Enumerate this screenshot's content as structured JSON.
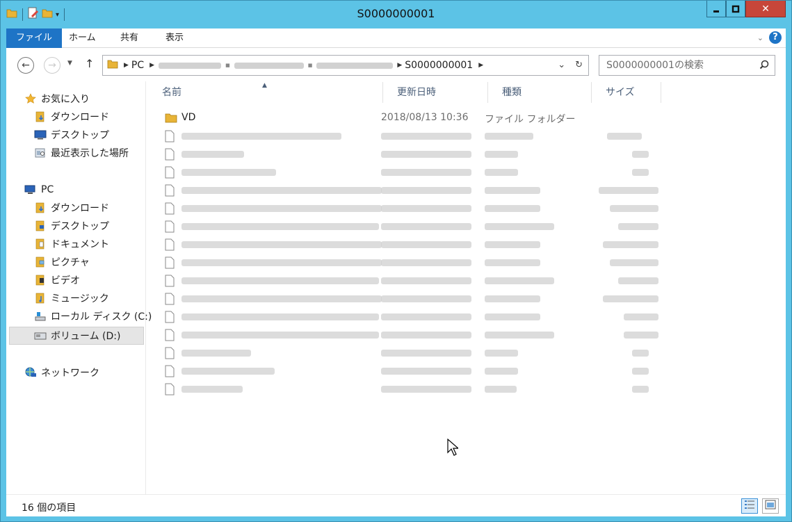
{
  "window": {
    "title": "S0000000001"
  },
  "ribbon": {
    "tabs": [
      {
        "label": "ファイル"
      },
      {
        "label": "ホーム"
      },
      {
        "label": "共有"
      },
      {
        "label": "表示"
      }
    ]
  },
  "address": {
    "crumbs": [
      "PC",
      "S0000000001"
    ],
    "search_placeholder": "S0000000001の検索"
  },
  "nav": {
    "favorites_label": "お気に入り",
    "favorites": [
      {
        "label": "ダウンロード",
        "icon": "download-folder-icon"
      },
      {
        "label": "デスクトップ",
        "icon": "desktop-icon"
      },
      {
        "label": "最近表示した場所",
        "icon": "recent-places-icon"
      }
    ],
    "pc_label": "PC",
    "pc_items": [
      {
        "label": "ダウンロード",
        "icon": "download-folder-icon"
      },
      {
        "label": "デスクトップ",
        "icon": "desktop-folder-icon"
      },
      {
        "label": "ドキュメント",
        "icon": "documents-folder-icon"
      },
      {
        "label": "ピクチャ",
        "icon": "pictures-folder-icon"
      },
      {
        "label": "ビデオ",
        "icon": "videos-folder-icon"
      },
      {
        "label": "ミュージック",
        "icon": "music-folder-icon"
      },
      {
        "label": "ローカル ディスク (C:)",
        "icon": "local-disk-icon"
      },
      {
        "label": "ボリューム (D:)",
        "icon": "volume-icon"
      }
    ],
    "network_label": "ネットワーク"
  },
  "columns": {
    "name": "名前",
    "date": "更新日時",
    "type": "種類",
    "size": "サイズ"
  },
  "files": [
    {
      "name": "VD",
      "date": "2018/08/13 10:36",
      "type": "ファイル フォルダー",
      "icon": "folder-icon"
    }
  ],
  "status": {
    "count": "16 個の項目"
  },
  "colors": {
    "title_bar": "#5cc3e6",
    "file_tab": "#1e74c6",
    "close_button": "#c7463a"
  }
}
